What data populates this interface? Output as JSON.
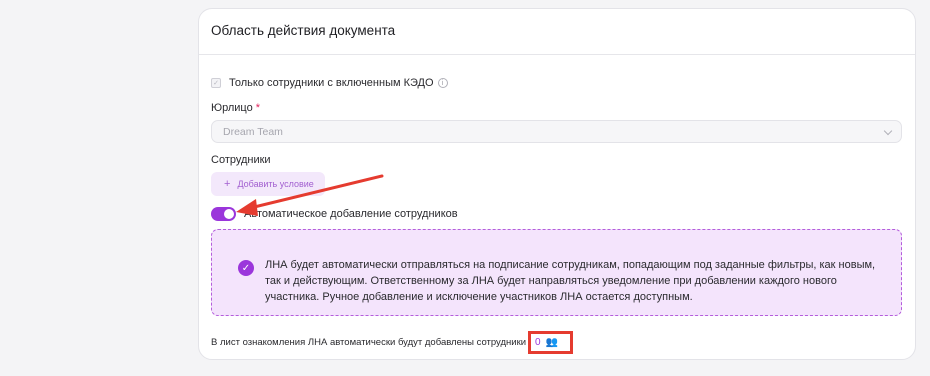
{
  "card": {
    "title": "Область действия документа",
    "only_kedo_label": "Только сотрудники с включенным КЭДО",
    "legal_entity": {
      "label": "Юрлицо",
      "required_mark": "*",
      "value": "Dream Team"
    },
    "employees": {
      "label": "Сотрудники",
      "add_condition_label": "Добавить условие"
    },
    "auto_add": {
      "label": "Автоматическое добавление сотрудников",
      "enabled": true
    },
    "info_text": "ЛНА будет автоматически отправляться на подписание сотрудникам, попадающим под заданные фильтры, как новым, так и действующим. Ответственному за ЛНА будет направляться уведомление при добавлении каждого нового участника. Ручное добавление и исключение участников ЛНА остается доступным.",
    "footer_text": "В лист ознакомления ЛНА автоматически будут добавлены сотрудники",
    "employee_count": "0"
  },
  "colors": {
    "accent": "#9b36db",
    "annotation": "#e53b2f"
  },
  "icons": [
    "checkbox-icon",
    "info-icon",
    "chevron-down-icon",
    "plus-icon",
    "check-circle-icon",
    "people-icon"
  ]
}
